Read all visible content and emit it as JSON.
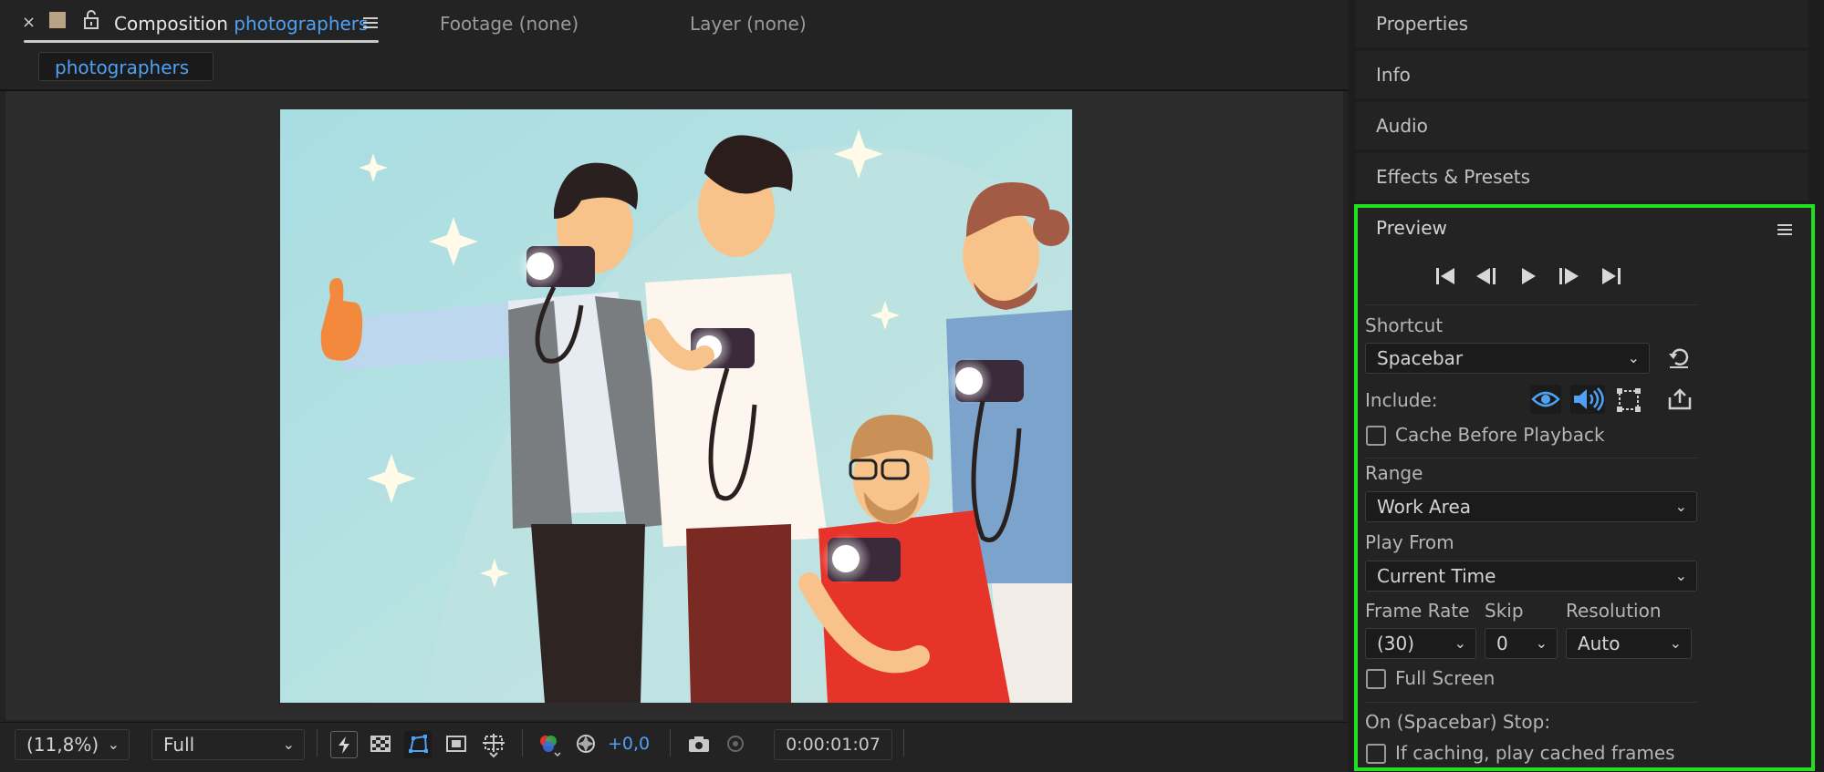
{
  "composition_panel": {
    "tabs": {
      "composition_prefix": "Composition",
      "composition_name": "photographers",
      "footage": "Footage (none)",
      "layer": "Layer (none)"
    },
    "subtab": "photographers",
    "bottom_bar": {
      "zoom": "(11,8%)",
      "resolution": "Full",
      "exposure": "+0,0",
      "timecode": "0:00:01:07"
    }
  },
  "panels": {
    "properties": "Properties",
    "info": "Info",
    "audio": "Audio",
    "effects_presets": "Effects & Presets"
  },
  "preview": {
    "title": "Preview",
    "shortcut_label": "Shortcut",
    "shortcut_value": "Spacebar",
    "include_label": "Include:",
    "cache_before_playback": "Cache Before Playback",
    "range_label": "Range",
    "range_value": "Work Area",
    "play_from_label": "Play From",
    "play_from_value": "Current Time",
    "frame_rate_label": "Frame Rate",
    "frame_rate_value": "(30)",
    "skip_label": "Skip",
    "skip_value": "0",
    "resolution_label": "Resolution",
    "resolution_value": "Auto",
    "full_screen": "Full Screen",
    "on_stop_label": "On (Spacebar) Stop:",
    "if_caching": "If caching, play cached frames"
  },
  "colors": {
    "accent_blue": "#4ea1f3",
    "highlight_green": "#21e021"
  }
}
